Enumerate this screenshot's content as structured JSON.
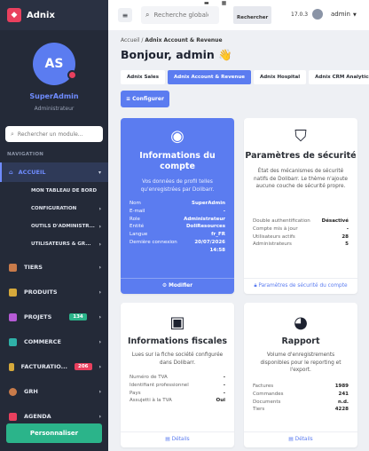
{
  "app": {
    "name": "Adnix"
  },
  "user": {
    "initials": "AS",
    "name": "SuperAdmin",
    "role": "Administrateur"
  },
  "sidebar": {
    "search_placeholder": "Rechercher un module...",
    "section_label": "NAVIGATION",
    "active_item": "ACCUEIL",
    "sub_items": [
      "MON TABLEAU DE BORD",
      "CONFIGURATION",
      "OUTILS D'ADMINISTR...",
      "UTILISATEURS & GR..."
    ],
    "items": [
      {
        "label": "TIERS",
        "icon": "building-icon",
        "color": "#c97b4a"
      },
      {
        "label": "PRODUITS",
        "icon": "box-icon",
        "color": "#d6a93b"
      },
      {
        "label": "PROJETS",
        "icon": "sitemap-icon",
        "color": "#b65bd6",
        "badge": "134",
        "badge_color": "#2bb48a"
      },
      {
        "label": "COMMERCE",
        "icon": "briefcase-icon",
        "color": "#2fb1a8"
      },
      {
        "label": "FACTURATIO...",
        "icon": "invoice-icon",
        "color": "#d6a93b",
        "badge": "206",
        "badge_color": "#e9405e"
      },
      {
        "label": "GRH",
        "icon": "person-icon",
        "color": "#c97b4a"
      },
      {
        "label": "AGENDA",
        "icon": "calendar-icon",
        "color": "#e9405e"
      }
    ],
    "customize_button": "Personnaliser"
  },
  "topbar": {
    "search_placeholder": "Recherche globale ...",
    "search_button": "Rechercher",
    "version": "17.0.3",
    "user_label": "admin"
  },
  "breadcrumb": {
    "home": "Accueil",
    "separator": "/",
    "current": "Adnix Account & Revenue"
  },
  "greeting": "Bonjour, admin 👋",
  "tabs": [
    "Adnix Sales",
    "Adnix Account & Revenue",
    "Adnix Hospital",
    "Adnix CRM Analytics"
  ],
  "configure_button": "Configurer",
  "cards": {
    "account": {
      "title": "Informations du compte",
      "desc": "Vos données de profil telles qu'enregistrées par Dolibarr.",
      "rows": [
        {
          "k": "Nom",
          "v": "SuperAdmin"
        },
        {
          "k": "E-mail",
          "v": "-"
        },
        {
          "k": "Role",
          "v": "Administrateur"
        },
        {
          "k": "Entité",
          "v": "DoliResources"
        },
        {
          "k": "Langue",
          "v": "fr_FR"
        },
        {
          "k": "Dernière connexion",
          "v": "20/07/2026 14:58"
        }
      ],
      "footer": "Modifier"
    },
    "security": {
      "title": "Paramètres de sécurité",
      "desc": "État des mécanismes de sécurité natifs de Dolibarr. Le thème n'ajoute aucune couche de sécurité propre.",
      "rows": [
        {
          "k": "Double authentification",
          "v": "Désactivé"
        },
        {
          "k": "Compte mis à jour",
          "v": "-"
        },
        {
          "k": "Utilisateurs actifs",
          "v": "28"
        },
        {
          "k": "Administrateurs",
          "v": "5"
        }
      ],
      "footer": "Paramètres de sécurité du compte"
    },
    "fiscal": {
      "title": "Informations fiscales",
      "desc": "Lues sur la fiche société configurée dans Dolibarr.",
      "rows": [
        {
          "k": "Numéro de TVA",
          "v": "-"
        },
        {
          "k": "Identifiant professionnel",
          "v": "-"
        },
        {
          "k": "Pays",
          "v": "-"
        },
        {
          "k": "Assujetti à la TVA",
          "v": "Oui"
        }
      ],
      "footer": "Détails"
    },
    "report": {
      "title": "Rapport",
      "desc": "Volume d'enregistrements disponibles pour le reporting et l'export.",
      "rows": [
        {
          "k": "Factures",
          "v": "1989"
        },
        {
          "k": "Commandes",
          "v": "241"
        },
        {
          "k": "Documents",
          "v": "n.d."
        },
        {
          "k": "Tiers",
          "v": "4228"
        }
      ],
      "footer": "Détails"
    }
  },
  "colors": {
    "accent": "#5b7cf0",
    "sidebar": "#242a38",
    "brand": "#e9405e",
    "success": "#2bb48a"
  }
}
